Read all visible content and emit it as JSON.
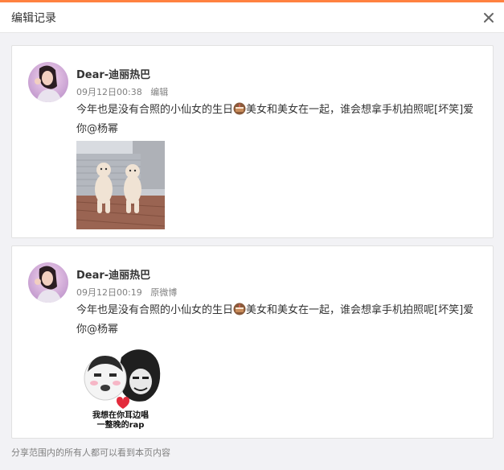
{
  "dialog": {
    "title": "编辑记录"
  },
  "records": [
    {
      "author": "Dear-迪丽热巴",
      "time": "09月12日00:38",
      "tag": "编辑",
      "text_before": "今年也是没有合照的小仙女的生日",
      "emoji_name": "cake-icon",
      "text_after": "美女和美女在一起，谁会想拿手机拍照呢[坏笑]爱你@杨幂"
    },
    {
      "author": "Dear-迪丽热巴",
      "time": "09月12日00:19",
      "tag": "原微博",
      "text_before": "今年也是没有合照的小仙女的生日",
      "emoji_name": "cake-icon",
      "text_after": "美女和美女在一起，谁会想拿手机拍照呢[坏笑]爱你@杨幂",
      "image_caption_line1": "我想在你耳边唱",
      "image_caption_line2": "一整晚的rap"
    }
  ],
  "footer": {
    "note": "分享范围内的所有人都可以看到本页内容"
  },
  "colors": {
    "accent": "#ff8140",
    "muted": "#808080",
    "background": "#f2f2f5"
  }
}
